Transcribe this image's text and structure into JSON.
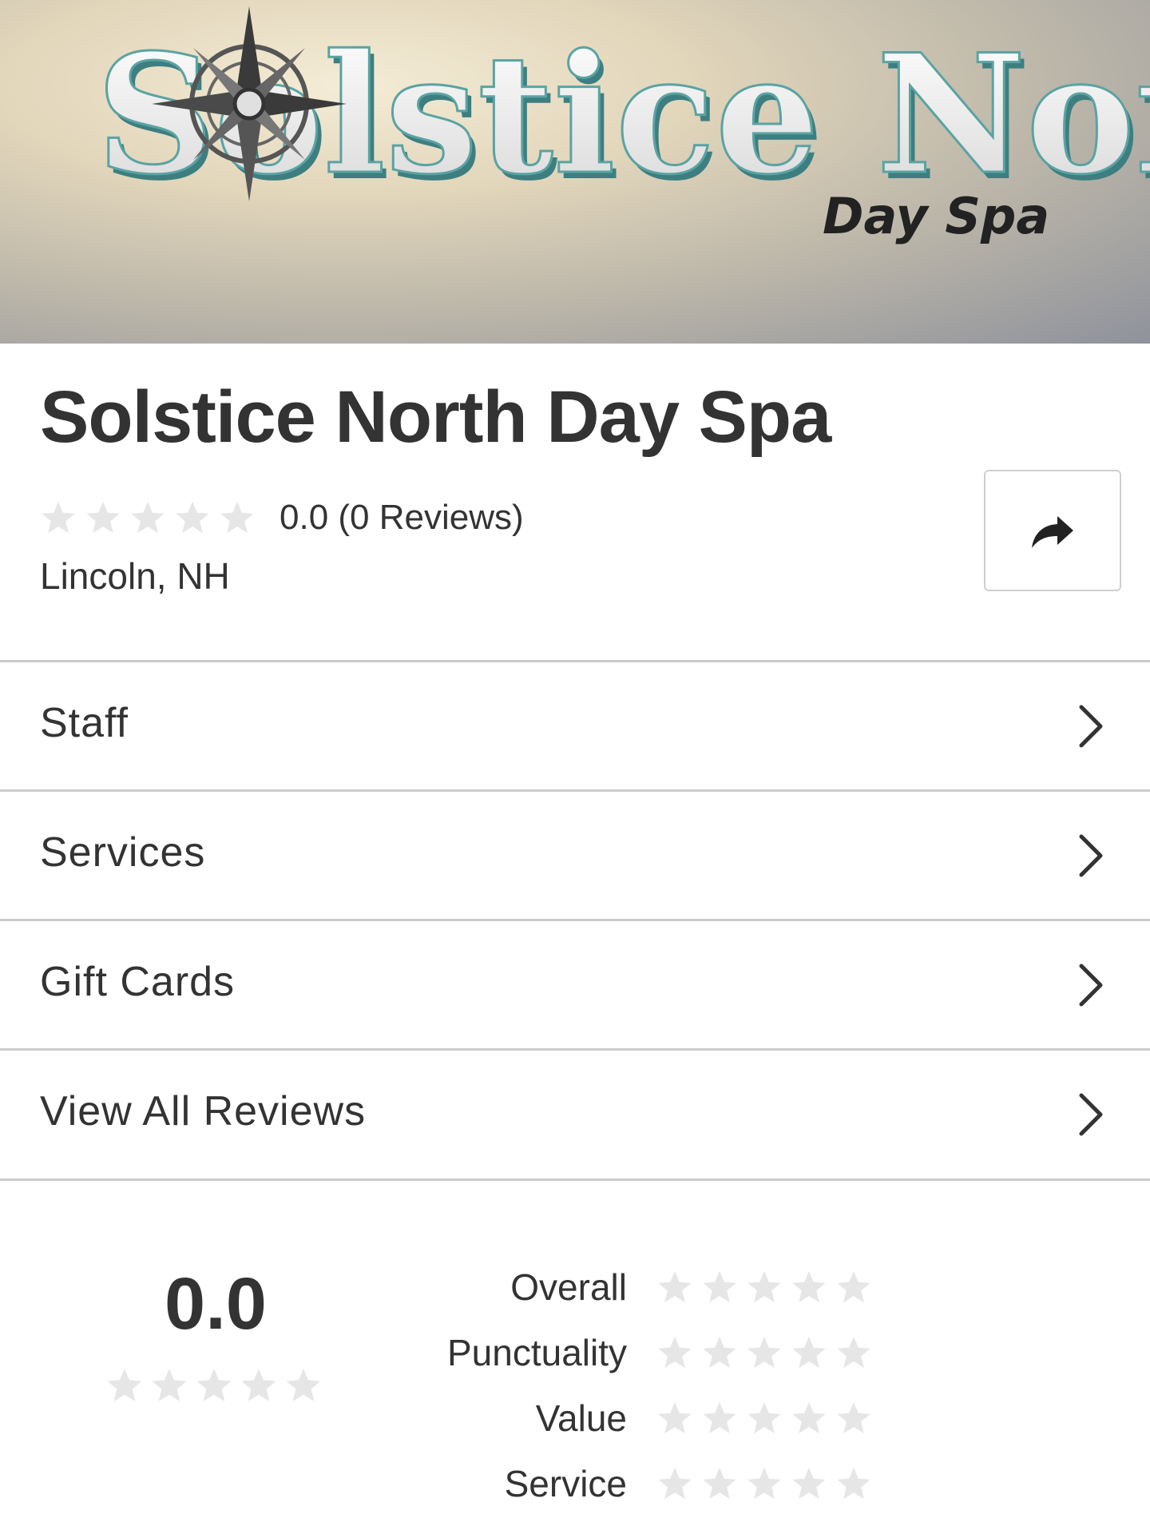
{
  "hero": {
    "sign_main": "Solstice North",
    "sign_sub": "Day Spa",
    "sign_icon": "compass-rose-icon"
  },
  "business": {
    "name": "Solstice North Day Spa",
    "rating_text": "0.0 (0 Reviews)",
    "rating_value": 0.0,
    "location": "Lincoln, NH",
    "share_icon": "share-arrow-icon"
  },
  "menu": {
    "items": [
      {
        "label": "Staff"
      },
      {
        "label": "Services"
      },
      {
        "label": "Gift Cards"
      },
      {
        "label": "View All Reviews"
      }
    ]
  },
  "summary": {
    "score": "0.0",
    "categories": [
      {
        "label": "Overall",
        "rating": 0
      },
      {
        "label": "Punctuality",
        "rating": 0
      },
      {
        "label": "Value",
        "rating": 0
      },
      {
        "label": "Service",
        "rating": 0
      }
    ]
  },
  "colors": {
    "text": "#333333",
    "star_empty": "#e6e6e6",
    "divider": "#cccccc"
  }
}
